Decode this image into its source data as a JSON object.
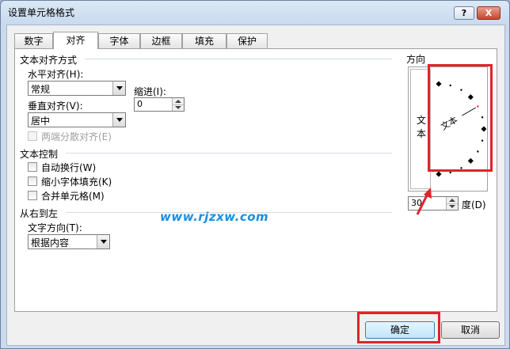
{
  "window": {
    "title": "设置单元格格式",
    "help_label": "?",
    "close_label": "X"
  },
  "tabs": [
    {
      "label": "数字",
      "active": false
    },
    {
      "label": "对齐",
      "active": true
    },
    {
      "label": "字体",
      "active": false
    },
    {
      "label": "边框",
      "active": false
    },
    {
      "label": "填充",
      "active": false
    },
    {
      "label": "保护",
      "active": false
    }
  ],
  "text_alignment": {
    "section_title": "文本对齐方式",
    "horizontal_label": "水平对齐(H):",
    "horizontal_value": "常规",
    "indent_label": "缩进(I):",
    "indent_value": "0",
    "vertical_label": "垂直对齐(V):",
    "vertical_value": "居中",
    "justify_distributed_label": "两端分散对齐(E)"
  },
  "text_control": {
    "section_title": "文本控制",
    "wrap_text_label": "自动换行(W)",
    "shrink_to_fit_label": "缩小字体填充(K)",
    "merge_cells_label": "合并单元格(M)"
  },
  "rtl": {
    "section_title": "从右到左",
    "direction_label": "文字方向(T):",
    "direction_value": "根据内容"
  },
  "orientation": {
    "section_title": "方向",
    "vertical_text": [
      "文",
      "本"
    ],
    "dial_text": "文本",
    "degrees_value": "30",
    "degrees_label": "度(D)",
    "angle": 30
  },
  "watermark": "www.rjzxw.com",
  "buttons": {
    "ok_label": "确定",
    "cancel_label": "取消"
  },
  "colors": {
    "highlight": "#e0232b",
    "watermark": "#1a8fe0"
  }
}
